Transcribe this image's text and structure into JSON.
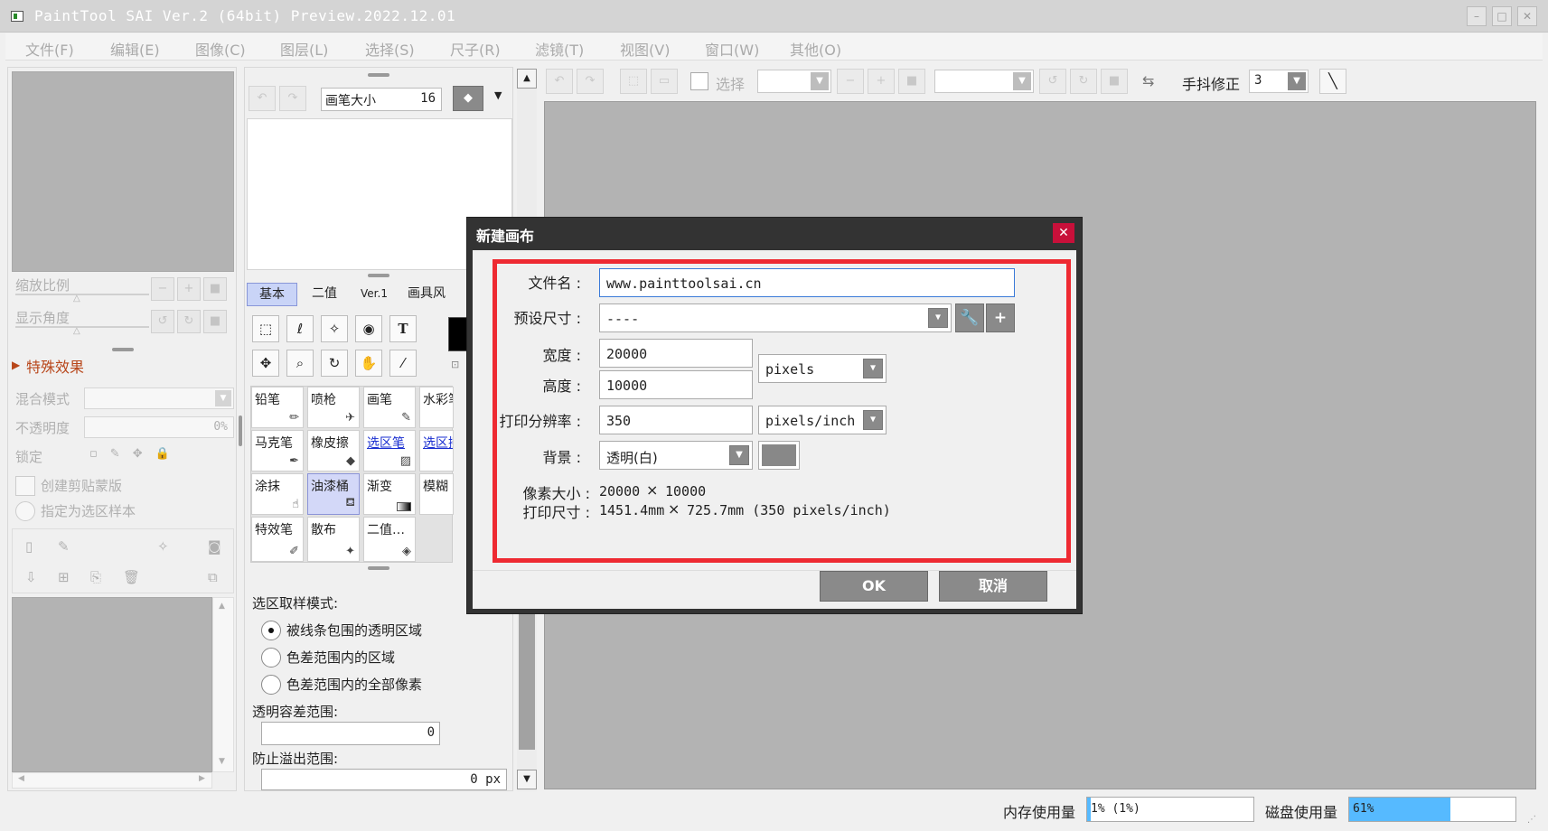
{
  "window": {
    "title": "PaintTool SAI Ver.2 (64bit) Preview.2022.12.01",
    "minimize": "–",
    "maximize": "□",
    "close": "✕"
  },
  "menu": [
    "文件(F)",
    "编辑(E)",
    "图像(C)",
    "图层(L)",
    "选择(S)",
    "尺子(R)",
    "滤镜(T)",
    "视图(V)",
    "窗口(W)",
    "其他(O)"
  ],
  "navigator": {
    "zoom_label": "缩放比例",
    "angle_label": "显示角度"
  },
  "layer_panel": {
    "effects_label": "特殊效果",
    "blend_label": "混合模式",
    "opacity_label": "不透明度",
    "opacity_value": "0%",
    "lock_label": "锁定",
    "clip_label": "创建剪贴蒙版",
    "sample_label": "指定为选区样本"
  },
  "brush_panel": {
    "size_label": "画笔大小",
    "size_value": "16",
    "tabs": [
      "基本",
      "二值",
      "Ver.1",
      "画具风"
    ],
    "brushes": [
      [
        "铅笔",
        "喷枪",
        "画笔",
        "水彩笔"
      ],
      [
        "马克笔",
        "橡皮擦",
        "选区笔",
        "选区擦"
      ],
      [
        "涂抹",
        "油漆桶",
        "渐变",
        "模糊"
      ],
      [
        "特效笔",
        "散布",
        "二值…",
        ""
      ]
    ]
  },
  "fill_options": {
    "mode_label": "选区取样模式:",
    "options": [
      "被线条包围的透明区域",
      "色差范围内的区域",
      "色差范围内的全部像素"
    ],
    "tolerance_label": "透明容差范围:",
    "tolerance_value": "0",
    "overflow_label": "防止溢出范围:",
    "overflow_value": "0 px"
  },
  "toolbar": {
    "select_label": "选择",
    "stabilizer_label": "手抖修正",
    "stabilizer_value": "3"
  },
  "dialog": {
    "title": "新建画布",
    "filename_label": "文件名 :",
    "filename_value": "www.painttoolsai.cn",
    "preset_label": "预设尺寸 :",
    "preset_value": "----",
    "width_label": "宽度 :",
    "width_value": "20000",
    "height_label": "高度 :",
    "height_value": "10000",
    "unit_value": "pixels",
    "dpi_label": "打印分辨率 :",
    "dpi_value": "350",
    "dpi_unit": "pixels/inch",
    "bg_label": "背景 :",
    "bg_value": "透明(白)",
    "pixel_size_label": "像素大小 :",
    "pixel_size_w": "20000",
    "pixel_size_x": "×",
    "pixel_size_h": "10000",
    "print_size_label": "打印尺寸 :",
    "print_size_w": "1451.4mm",
    "print_size_x": "×",
    "print_size_h": "725.7mm (350 pixels/inch)",
    "ok_label": "OK",
    "cancel_label": "取消"
  },
  "status": {
    "memory_label": "内存使用量",
    "memory_value": "1% (1%)",
    "disk_label": "磁盘使用量",
    "disk_value": "61%",
    "disk_fraction": 0.61
  }
}
